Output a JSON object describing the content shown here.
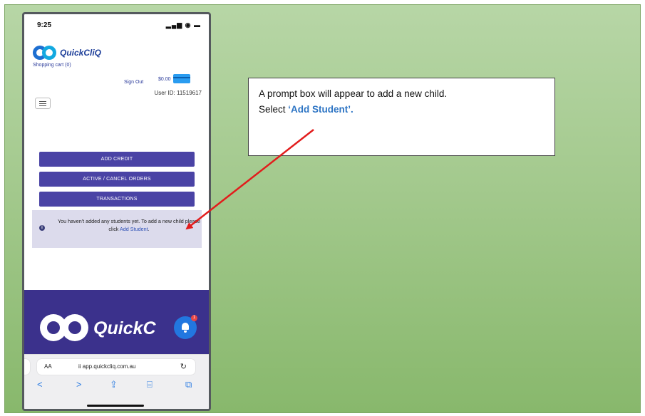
{
  "status_bar": {
    "time": "9:25",
    "icons": "▂▄▆ ◉ ▬"
  },
  "app": {
    "logo_text": "QuickCliQ",
    "shopping_cart": "Shopping cart (0)",
    "sign_out": "Sign Out",
    "balance": "$0.00",
    "user_id": "User ID: 11519617"
  },
  "buttons": {
    "add_credit": "ADD CREDIT",
    "active_cancel_orders": "ACTIVE / CANCEL ORDERS",
    "transactions": "TRANSACTIONS"
  },
  "alert": {
    "icon": "i",
    "message_before": "You haven't added any students yet. To add a new child please click ",
    "link": "Add Student",
    "message_after": "."
  },
  "footer": {
    "logo_text": "QuickC",
    "badge": "1"
  },
  "browser": {
    "text_size": "AA",
    "url": "ii app.quickcliq.com.au",
    "reload": "↻",
    "nav": {
      "back": "<",
      "forward": ">",
      "share": "⇪",
      "bookmarks": "⌸",
      "tabs": "⧉"
    }
  },
  "callout": {
    "line1": "A prompt box will appear to add a new child.",
    "line2_prefix": "Select ",
    "line2_highlight": "‘Add Student’."
  },
  "colors": {
    "button": "#4a43a5",
    "footer": "#3b318c",
    "arrow": "#e21c1c",
    "highlight": "#2e75c4"
  }
}
